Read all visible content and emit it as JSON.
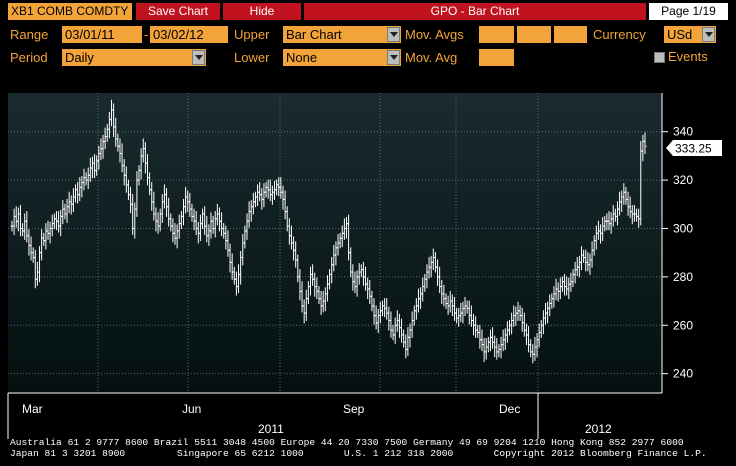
{
  "header": {
    "ticker": "XB1 COMB COMDTY",
    "save_chart": "Save Chart",
    "hide": "Hide",
    "title": "GPO - Bar Chart",
    "page": "Page 1/19"
  },
  "controls": {
    "range_label": "Range",
    "range_start": "03/01/11",
    "range_sep": "-",
    "range_end": "03/02/12",
    "upper_label": "Upper",
    "upper_value": "Bar Chart",
    "mov_avgs_label": "Mov. Avgs",
    "currency_label": "Currency",
    "currency_value": "USd",
    "period_label": "Period",
    "period_value": "Daily",
    "lower_label": "Lower",
    "lower_value": "None",
    "mov_avg_label": "Mov. Avg",
    "events_label": "Events"
  },
  "colors": {
    "accent": "#F2A43A",
    "button_red": "#C1121F",
    "panel_top": "#1A2B2F",
    "panel_bottom": "#041010",
    "bars": "#FFFFFF"
  },
  "chart_data": {
    "type": "bar",
    "ylim": [
      232,
      356
    ],
    "y_ticks": [
      240,
      260,
      280,
      300,
      320,
      340
    ],
    "last_price": "333.25",
    "x_month_labels": [
      "Mar",
      "Jun",
      "Sep",
      "Dec"
    ],
    "x_year_labels": [
      "2011",
      "2012"
    ],
    "grid": true,
    "series": [
      {
        "values": [
          301,
          305,
          303,
          306,
          300,
          299,
          303,
          297,
          293,
          290,
          288,
          279,
          282,
          290,
          296,
          295,
          299,
          298,
          300,
          302,
          304,
          303,
          301,
          305,
          308,
          306,
          309,
          311,
          310,
          313,
          316,
          314,
          317,
          319,
          321,
          320,
          322,
          325,
          327,
          324,
          328,
          331,
          333,
          336,
          338,
          341,
          345,
          349,
          342,
          337,
          334,
          331,
          326,
          322,
          318,
          314,
          310,
          300,
          308,
          320,
          324,
          330,
          333,
          327,
          321,
          316,
          311,
          306,
          303,
          301,
          306,
          311,
          314,
          309,
          304,
          301,
          298,
          296,
          299,
          302,
          305,
          309,
          313,
          311,
          308,
          305,
          303,
          300,
          298,
          302,
          306,
          301,
          297,
          299,
          303,
          300,
          304,
          306,
          303,
          300,
          298,
          295,
          291,
          286,
          282,
          279,
          276,
          281,
          288,
          294,
          299,
          303,
          307,
          309,
          311,
          313,
          315,
          314,
          312,
          315,
          317,
          316,
          314,
          315,
          316,
          318,
          317,
          315,
          312,
          307,
          301,
          297,
          294,
          291,
          287,
          280,
          274,
          268,
          265,
          271,
          276,
          281,
          279,
          276,
          274,
          271,
          268,
          270,
          273,
          277,
          281,
          285,
          289,
          292,
          294,
          296,
          298,
          300,
          302,
          290,
          282,
          278,
          276,
          280,
          282,
          283,
          280,
          277,
          275,
          272,
          268,
          264,
          261,
          264,
          266,
          268,
          267,
          265,
          262,
          258,
          256,
          260,
          262,
          259,
          256,
          253,
          250,
          255,
          258,
          262,
          266,
          268,
          271,
          273,
          276,
          279,
          282,
          284,
          286,
          288,
          284,
          280,
          276,
          273,
          271,
          269,
          268,
          270,
          268,
          265,
          263,
          264,
          265,
          267,
          268,
          267,
          264,
          262,
          260,
          258,
          257,
          254,
          252,
          249,
          251,
          253,
          255,
          253,
          251,
          249,
          250,
          252,
          254,
          256,
          258,
          260,
          262,
          264,
          265,
          266,
          264,
          261,
          258,
          256,
          252,
          249,
          248,
          251,
          254,
          257,
          260,
          263,
          265,
          267,
          269,
          271,
          273,
          275,
          274,
          276,
          278,
          276,
          275,
          277,
          278,
          281,
          283,
          284,
          286,
          289,
          288,
          286,
          285,
          287,
          291,
          295,
          298,
          299,
          298,
          301,
          303,
          303,
          302,
          304,
          306,
          305,
          308,
          311,
          313,
          315,
          312,
          309,
          307,
          306,
          306,
          305,
          304,
          332,
          336,
          334
        ]
      }
    ]
  },
  "footer": {
    "contact_line1": "Australia 61 2 9777 8600 Brazil 5511 3048 4500 Europe 44 20 7330 7500 Germany 49 69 9204 1210 Hong Kong 852 2977 6000",
    "contact_line2": "Japan 81 3 3201 8900         Singapore 65 6212 1000       U.S. 1 212 318 2000       Copyright 2012 Bloomberg Finance L.P."
  }
}
